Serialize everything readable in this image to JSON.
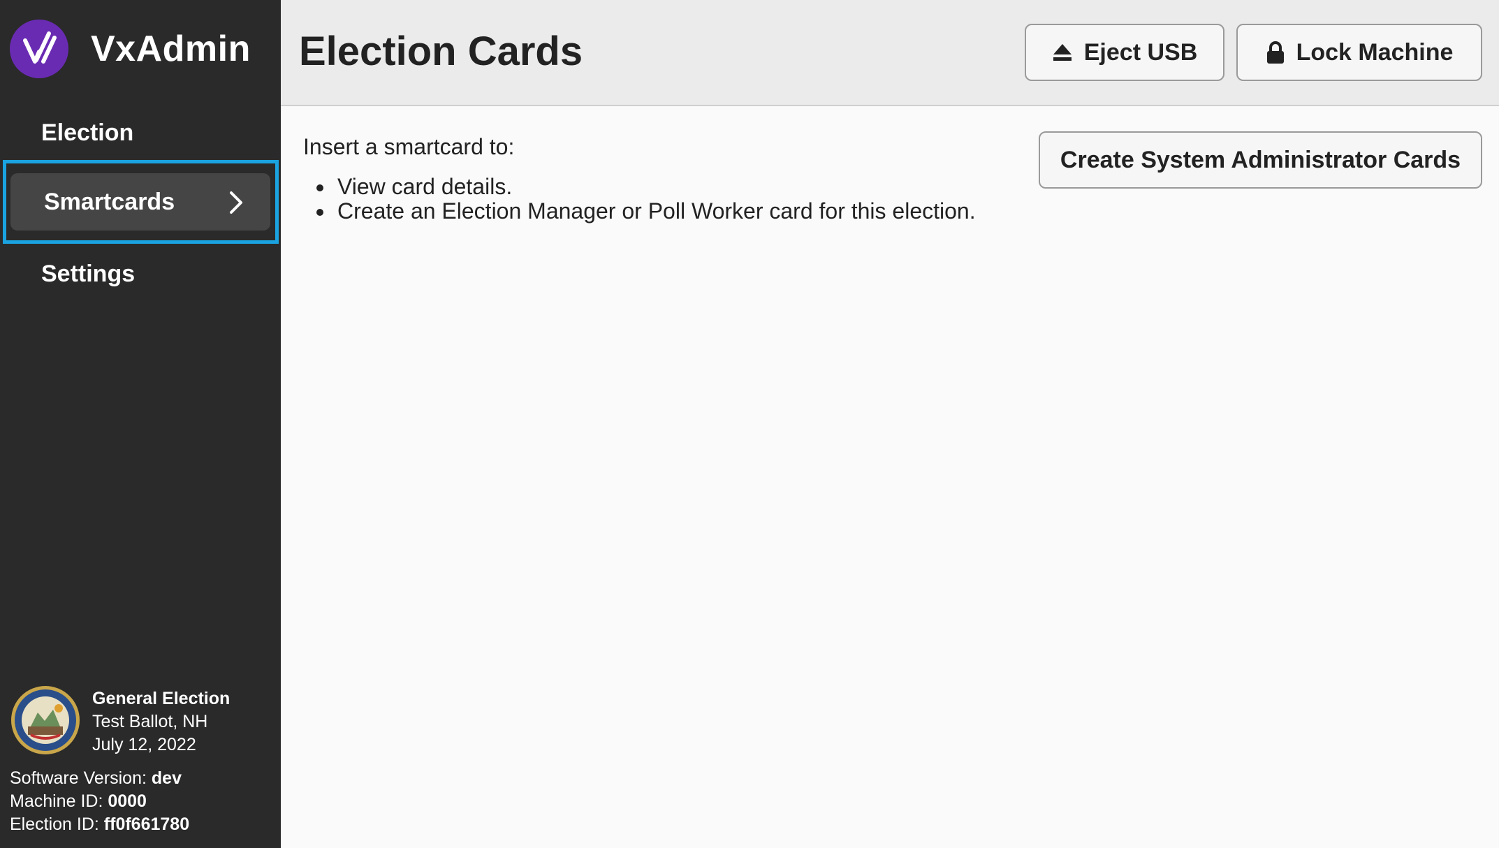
{
  "app": {
    "name": "VxAdmin",
    "logo_icon": "vx-logo-icon",
    "accent_color": "#6a2bb3"
  },
  "sidebar": {
    "items": [
      {
        "label": "Election"
      },
      {
        "label": "Smartcards",
        "active": true
      },
      {
        "label": "Settings"
      }
    ],
    "active_border_color": "#1aa3e0"
  },
  "election": {
    "title": "General Election",
    "subtitle": "Test Ballot, NH",
    "date": "July 12, 2022",
    "seal_icon": "state-seal-icon"
  },
  "meta": {
    "software_label": "Software Version:",
    "software_value": "dev",
    "machine_label": "Machine ID:",
    "machine_value": "0000",
    "election_id_label": "Election ID:",
    "election_id_value": "ff0f661780"
  },
  "header": {
    "title": "Election Cards",
    "eject_label": "Eject USB",
    "lock_label": "Lock Machine"
  },
  "content": {
    "instruction": "Insert a smartcard to:",
    "bullets": [
      "View card details.",
      "Create an Election Manager or Poll Worker card for this election."
    ],
    "create_button_label": "Create System Administrator Cards"
  }
}
